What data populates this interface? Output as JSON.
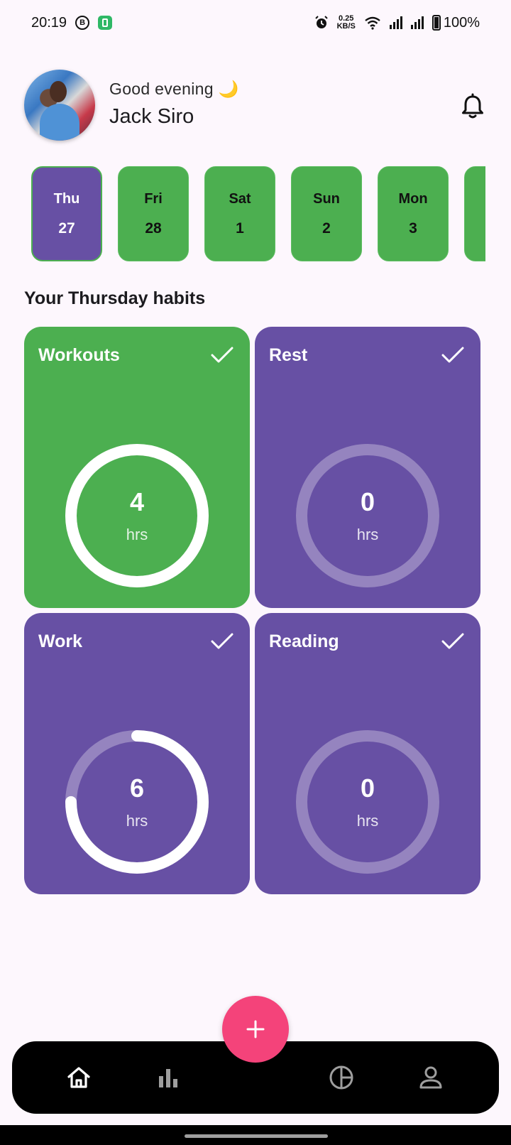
{
  "status_bar": {
    "time": "20:19",
    "network_speed_value": "0.25",
    "network_speed_unit": "KB/S",
    "battery": "100%"
  },
  "header": {
    "greeting": "Good evening 🌙",
    "user_name": "Jack Siro"
  },
  "dates": [
    {
      "day": "Thu",
      "num": "27",
      "selected": true
    },
    {
      "day": "Fri",
      "num": "28",
      "selected": false
    },
    {
      "day": "Sat",
      "num": "1",
      "selected": false
    },
    {
      "day": "Sun",
      "num": "2",
      "selected": false
    },
    {
      "day": "Mon",
      "num": "3",
      "selected": false
    },
    {
      "day": "",
      "num": "",
      "selected": false
    }
  ],
  "section_title": "Your Thursday habits",
  "habits": [
    {
      "name": "Workouts",
      "value": "4",
      "unit": "hrs",
      "progress": 1.0,
      "color": "#4caf50"
    },
    {
      "name": "Rest",
      "value": "0",
      "unit": "hrs",
      "progress": 0.0,
      "color": "#6750a4"
    },
    {
      "name": "Work",
      "value": "6",
      "unit": "hrs",
      "progress": 0.75,
      "color": "#6750a4"
    },
    {
      "name": "Reading",
      "value": "0",
      "unit": "hrs",
      "progress": 0.0,
      "color": "#6750a4"
    }
  ],
  "nav": {
    "icons": [
      "home-icon",
      "bar-chart-icon",
      "pie-chart-icon",
      "person-icon"
    ]
  },
  "colors": {
    "primary": "#6750a4",
    "green": "#4caf50",
    "fab": "#f4437a"
  }
}
